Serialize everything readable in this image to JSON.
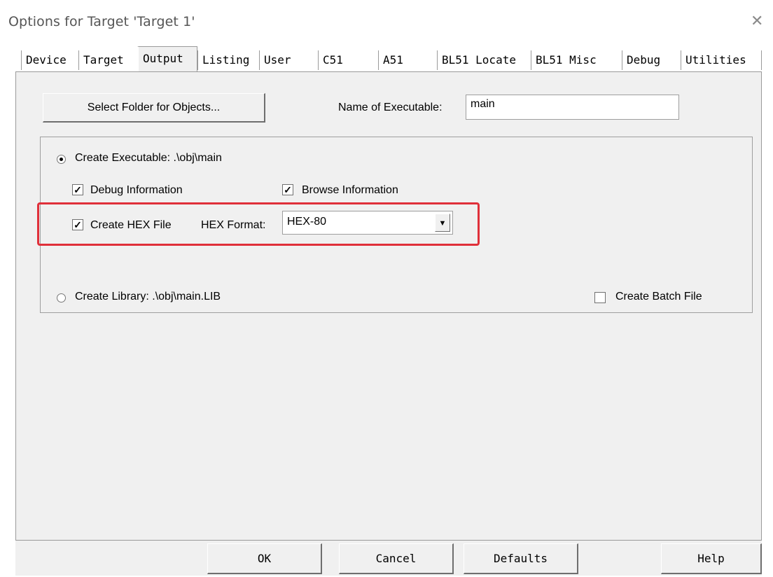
{
  "window": {
    "title": "Options for Target 'Target 1'"
  },
  "tabs": [
    "Device",
    "Target",
    "Output",
    "Listing",
    "User",
    "C51",
    "A51",
    "BL51 Locate",
    "BL51 Misc",
    "Debug",
    "Utilities"
  ],
  "active_tab": "Output",
  "output": {
    "select_folder_label": "Select Folder for Objects...",
    "name_label": "Name of Executable:",
    "name_value": "main",
    "create_executable_label": "Create Executable:  .\\obj\\main",
    "debug_info_label": "Debug Information",
    "browse_info_label": "Browse Information",
    "create_hex_label": "Create HEX File",
    "hex_format_label": "HEX Format:",
    "hex_format_value": "HEX-80",
    "create_library_label": "Create Library:  .\\obj\\main.LIB",
    "create_batch_label": "Create Batch File",
    "selected_radio": "create-executable",
    "checked": {
      "debug_information": true,
      "browse_information": true,
      "create_hex_file": true,
      "create_batch_file": false
    }
  },
  "footer": {
    "ok": "OK",
    "cancel": "Cancel",
    "defaults": "Defaults",
    "help": "Help"
  },
  "icons": {
    "close": "close-icon",
    "dropdown": "chevron-down-icon"
  },
  "colors": {
    "highlight": "#e0303a"
  }
}
